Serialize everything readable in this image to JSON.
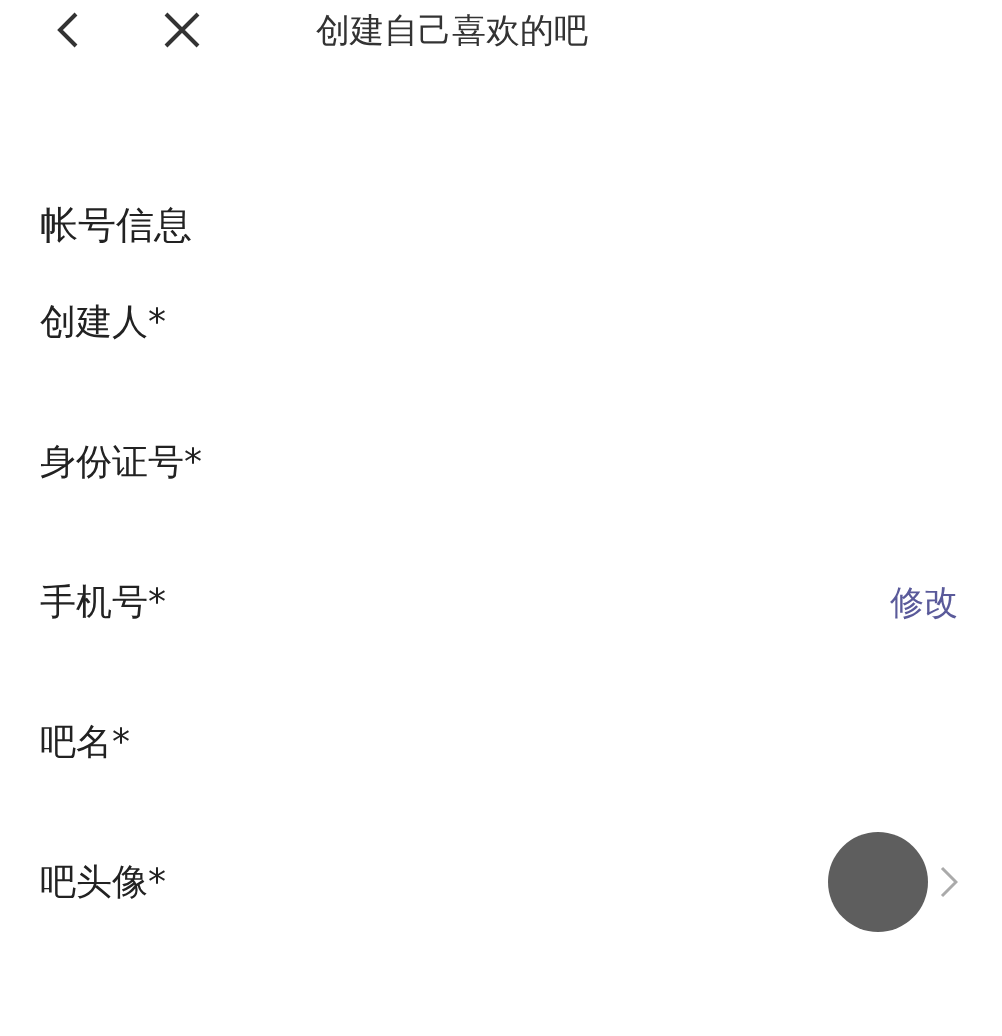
{
  "header": {
    "title": "创建自己喜欢的吧"
  },
  "section": {
    "title": "帐号信息"
  },
  "fields": [
    {
      "kind": "text",
      "label": "创建人*"
    },
    {
      "kind": "text",
      "label": "身份证号*"
    },
    {
      "kind": "action",
      "label": "手机号*",
      "action": "修改"
    },
    {
      "kind": "text",
      "label": "吧名*"
    },
    {
      "label": "吧头像*"
    }
  ]
}
